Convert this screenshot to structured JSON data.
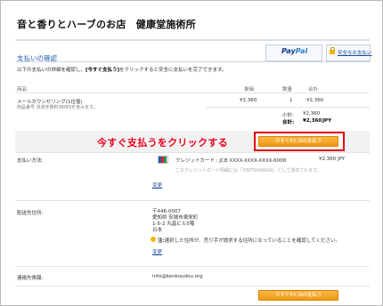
{
  "header": {
    "shop_title": "音と香りとハーブのお店　健康堂施術所"
  },
  "paypal": {
    "logo_pay": "Pay",
    "logo_pal": "Pal",
    "secure_link": "安全なお支払い"
  },
  "section": {
    "title": "支払いの確認",
    "intro_prefix": "以下の支払いの詳細を確認し、",
    "intro_bold": "[今すぐ支払う]",
    "intro_suffix": "をクリックすると安全に支払いを完了できます。"
  },
  "table": {
    "headers": {
      "item": "商品",
      "price": "単価",
      "qty": "数量",
      "total": "合計"
    },
    "item": {
      "name": "メールカウンセリング(1往復)",
      "sub": "商品番号 決済手数料360円を含みます。",
      "price": "¥2,360",
      "qty": "1",
      "total": "¥2,360"
    },
    "subtotal_label": "小計:",
    "subtotal_value": "¥2,360",
    "total_label": "合計:",
    "total_value": "¥2,360",
    "total_currency": "JPY"
  },
  "annotation": {
    "text": "今すぐ支払うをクリックする"
  },
  "pay_button": {
    "label": "今すぐ¥2,360支払う"
  },
  "payment": {
    "label": "支払い方法:",
    "card_text": "クレジットカード : JCB XXXX-XXXX-XXXX-6008",
    "amount": "¥2,360 JPY",
    "note": "このクレジットカード明細には「YINTOXIANGR」として請求されます。",
    "change_link": "変更"
  },
  "shipping": {
    "label": "配送先住所:",
    "lines": [
      "〒446-0007",
      "愛知県 安城市東栄町",
      "1-5-2 丸昌ビル5階",
      "日本"
    ],
    "warning_bold": "注:",
    "warning_text": "選択した住所が、売り手が請求する住所になっていることを確認してください。",
    "change_link": "変更"
  },
  "contact": {
    "label": "連絡先情報:",
    "email": "info@kenkoudou.org"
  },
  "bottom_button": {
    "label": "今すぐ¥2,360支払う"
  },
  "colors": {
    "accent_blue": "#2a5ca8",
    "annotation_red": "#e8001c",
    "button_orange": "#ef9a12"
  }
}
